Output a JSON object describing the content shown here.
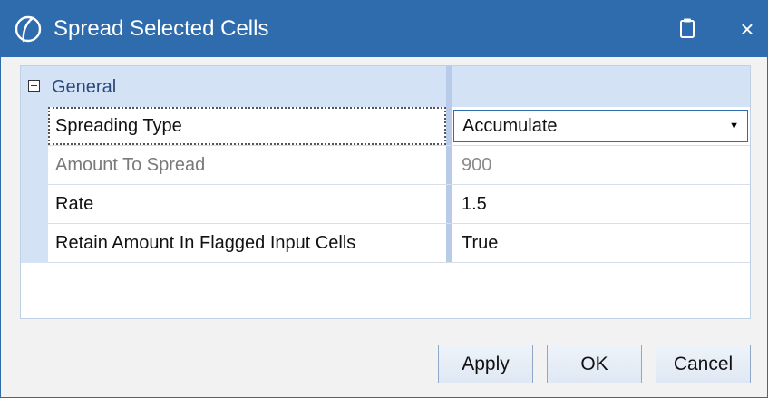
{
  "dialog": {
    "title": "Spread Selected Cells",
    "logo_icon": "ontology-logo-icon",
    "clipboard_icon": "clipboard-icon",
    "close_label": "×"
  },
  "grid": {
    "group": {
      "label": "General",
      "expander_icon": "collapse-minus-icon"
    },
    "properties": [
      {
        "name": "Spreading Type",
        "value": "Accumulate",
        "editor": "dropdown",
        "enabled": true
      },
      {
        "name": "Amount To Spread",
        "value": "900",
        "editor": "text",
        "enabled": false
      },
      {
        "name": "Rate",
        "value": "1.5",
        "editor": "text",
        "enabled": true
      },
      {
        "name": "Retain Amount In Flagged Input Cells",
        "value": "True",
        "editor": "text",
        "enabled": true
      }
    ]
  },
  "buttons": {
    "apply": "Apply",
    "ok": "OK",
    "cancel": "Cancel"
  },
  "colors": {
    "titlebar": "#2f6cad",
    "grid_header": "#d4e2f6",
    "splitter": "#b8cbe8"
  }
}
